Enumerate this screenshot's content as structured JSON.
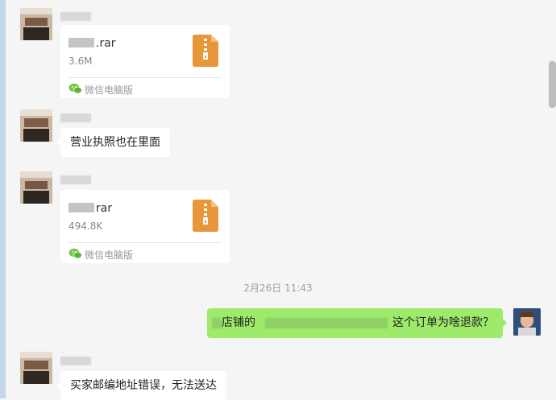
{
  "timestamp": "2月26日 11:43",
  "messages": [
    {
      "type": "file",
      "file_ext": ".rar",
      "size": "3.6M",
      "source": "微信电脑版"
    },
    {
      "type": "text",
      "text": "营业执照也在里面"
    },
    {
      "type": "file",
      "file_ext": "rar",
      "size": "494.8K",
      "source": "微信电脑版"
    },
    {
      "type": "text",
      "text": "买家邮编地址错误，无法送达"
    }
  ],
  "sent_message": {
    "text_start": "店铺的",
    "text_end": "这个订单为啥退款？"
  },
  "icons": [
    "zip-file-icon",
    "wechat-icon"
  ],
  "colors": {
    "zip_icon": "#e8963a",
    "sent_bubble": "#9eea6a",
    "background": "#f5f5f5"
  }
}
